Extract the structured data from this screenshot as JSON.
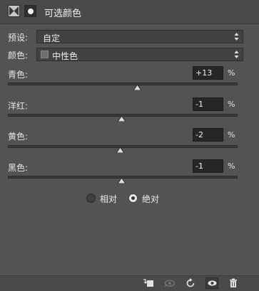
{
  "header": {
    "title": "可选颜色"
  },
  "preset": {
    "label": "预设:",
    "value": "自定"
  },
  "colors": {
    "label": "颜色:",
    "value": "中性色",
    "swatch_color": "#6f6f6f"
  },
  "sliders": [
    {
      "label": "青色:",
      "value": "+13",
      "unit": "%",
      "level": 0.565
    },
    {
      "label": "洋红:",
      "value": "-1",
      "unit": "%",
      "level": 0.495
    },
    {
      "label": "黄色:",
      "value": "-2",
      "unit": "%",
      "level": 0.49
    },
    {
      "label": "黑色:",
      "value": "-1",
      "unit": "%",
      "level": 0.495
    }
  ],
  "method": {
    "options": [
      {
        "label": "相对",
        "checked": false
      },
      {
        "label": "绝对",
        "checked": true
      }
    ]
  },
  "footer": {
    "icons": [
      "clip-to-layer-icon",
      "view-previous-icon",
      "reset-icon",
      "visibility-eye-icon",
      "trash-icon"
    ]
  },
  "colors_theme": {
    "panel_bg": "#535353",
    "input_bg": "#262626",
    "track_bg": "#3a3a3a"
  }
}
